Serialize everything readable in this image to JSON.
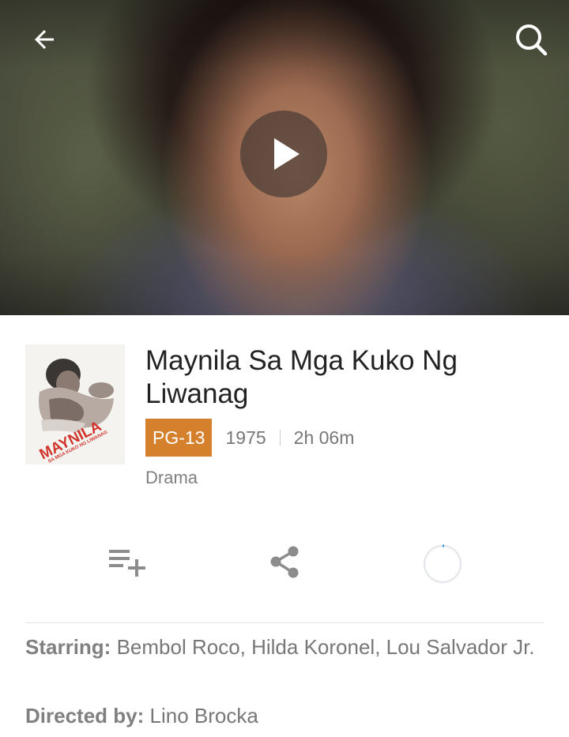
{
  "hero": {
    "back_icon": "arrow-left-icon",
    "search_icon": "search-icon",
    "play_icon": "play-icon"
  },
  "movie": {
    "title": "Maynila Sa Mga Kuko Ng Liwanag",
    "rating": "PG-13",
    "year": "1975",
    "duration": "2h 06m",
    "genre": "Drama",
    "poster_text": {
      "main": "MAYNILA",
      "sub": "SA MGA KUKO NG LIWANAG"
    }
  },
  "actions": [
    {
      "icon": "playlist-add-icon"
    },
    {
      "icon": "share-icon"
    },
    {
      "icon": "loading-spinner-icon"
    }
  ],
  "credits": {
    "starring_label": "Starring:",
    "starring_value": "Bembol Roco, Hilda Koronel, Lou Salvador Jr.",
    "director_label": "Directed by:",
    "director_value": "Lino Brocka"
  },
  "colors": {
    "rating_badge": "#d4802c",
    "spinner_accent": "#1e88e5"
  }
}
